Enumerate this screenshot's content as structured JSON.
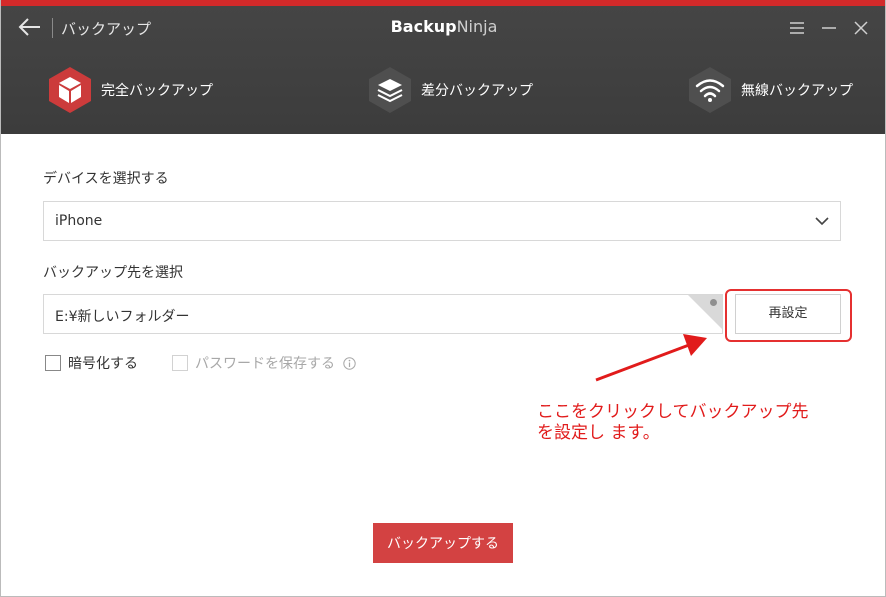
{
  "colors": {
    "accent": "#d32a2a",
    "header_bg": "#424242",
    "hex_active": "#cc3b3b",
    "hex_inactive": "#4f4f4f",
    "primary_button": "#d34242",
    "annotation": "#e11b1b"
  },
  "titlebar": {
    "back_icon": "arrow-left-icon",
    "page_title": "バックアップ",
    "app_name_bold": "Backup",
    "app_name_light": "Ninja",
    "controls": [
      "menu-icon",
      "minimize-icon",
      "close-icon"
    ]
  },
  "modes": [
    {
      "label": "完全バックアップ",
      "icon": "cube-icon",
      "active": true
    },
    {
      "label": "差分バックアップ",
      "icon": "layers-icon",
      "active": false
    },
    {
      "label": "無線バックアップ",
      "icon": "wifi-icon",
      "active": false
    }
  ],
  "device": {
    "label": "デバイスを選択する",
    "selected": "iPhone"
  },
  "destination": {
    "label": "バックアップ先を選択",
    "path": "E:¥新しいフォルダー",
    "reset_label": "再設定"
  },
  "options": {
    "encrypt_label": "暗号化する",
    "save_password_label": "パスワードを保存する"
  },
  "annotation": {
    "line1": "ここをクリックしてバックアップ先",
    "line2": "を設定し ます。"
  },
  "backup_button": "バックアップする"
}
